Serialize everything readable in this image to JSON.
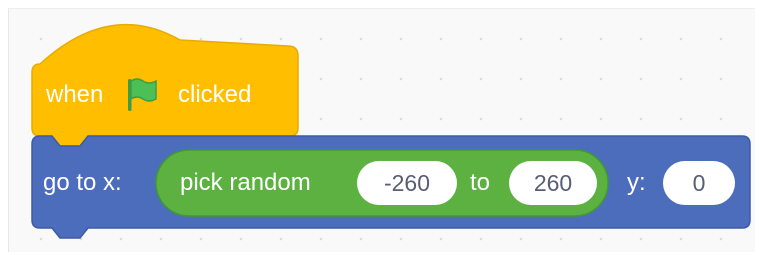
{
  "hat_block": {
    "label_before": "when",
    "icon": "green-flag-icon",
    "label_after": "clicked",
    "color": "#ffbf00",
    "border_color": "#e6ac00"
  },
  "motion_block": {
    "label": "go to x:",
    "y_label": "y:",
    "y_value": "0",
    "color": "#4c6cbc",
    "border_color": "#3d5aa8"
  },
  "operator_block": {
    "label": "pick random",
    "from_value": "-260",
    "to_label": "to",
    "to_value": "260",
    "color": "#5cb141",
    "border_color": "#3f9a2f"
  },
  "colors": {
    "flag_green": "#4cbf56",
    "input_text": "#575e75"
  }
}
